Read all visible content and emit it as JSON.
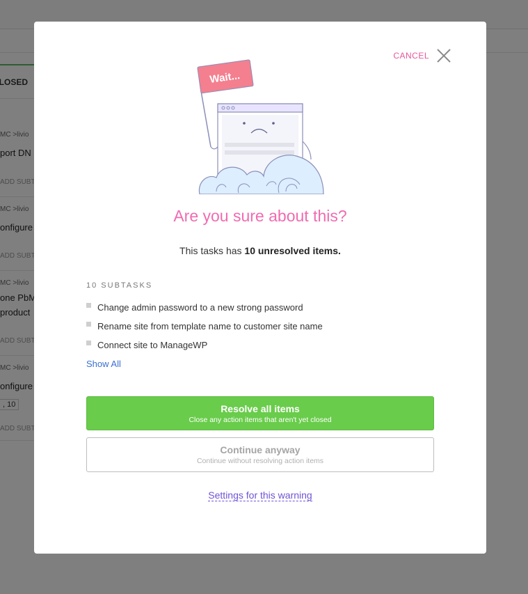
{
  "background": {
    "tab_label": "CLOSED",
    "rows": [
      {
        "crumb": "MC  >livio",
        "title": "port DN",
        "add": "ADD SUBT"
      },
      {
        "crumb": "MC  >livio",
        "title": "onfigure",
        "add": "ADD SUBT"
      },
      {
        "crumb": "MC  >livio",
        "title": "one PbM",
        "title2": "product",
        "add": "ADD SUBT"
      },
      {
        "crumb": "MC  >livio",
        "title": "onfigure",
        "tag": ", 10",
        "add": "ADD SUBT"
      }
    ]
  },
  "modal": {
    "cancel_label": "CANCEL",
    "illustration": {
      "flag_text": "Wait..."
    },
    "title": "Are you sure about this?",
    "summary_prefix": "This tasks has ",
    "summary_bold": "10 unresolved items.",
    "subtasks_heading": "10 SUBTASKS",
    "subtasks": [
      "Change admin password to a new strong password",
      "Rename site from template name to customer site name",
      "Connect site to ManageWP"
    ],
    "show_all_label": "Show All",
    "resolve_button": {
      "label": "Resolve all items",
      "sublabel": "Close any action items that aren't yet closed"
    },
    "continue_button": {
      "label": "Continue anyway",
      "sublabel": "Continue without resolving action items"
    },
    "settings_link": "Settings for this warning"
  },
  "colors": {
    "accent_pink": "#f06bb0",
    "resolve_green": "#69cc4b",
    "link_blue": "#3a6fd0",
    "link_purple": "#7152d6"
  }
}
